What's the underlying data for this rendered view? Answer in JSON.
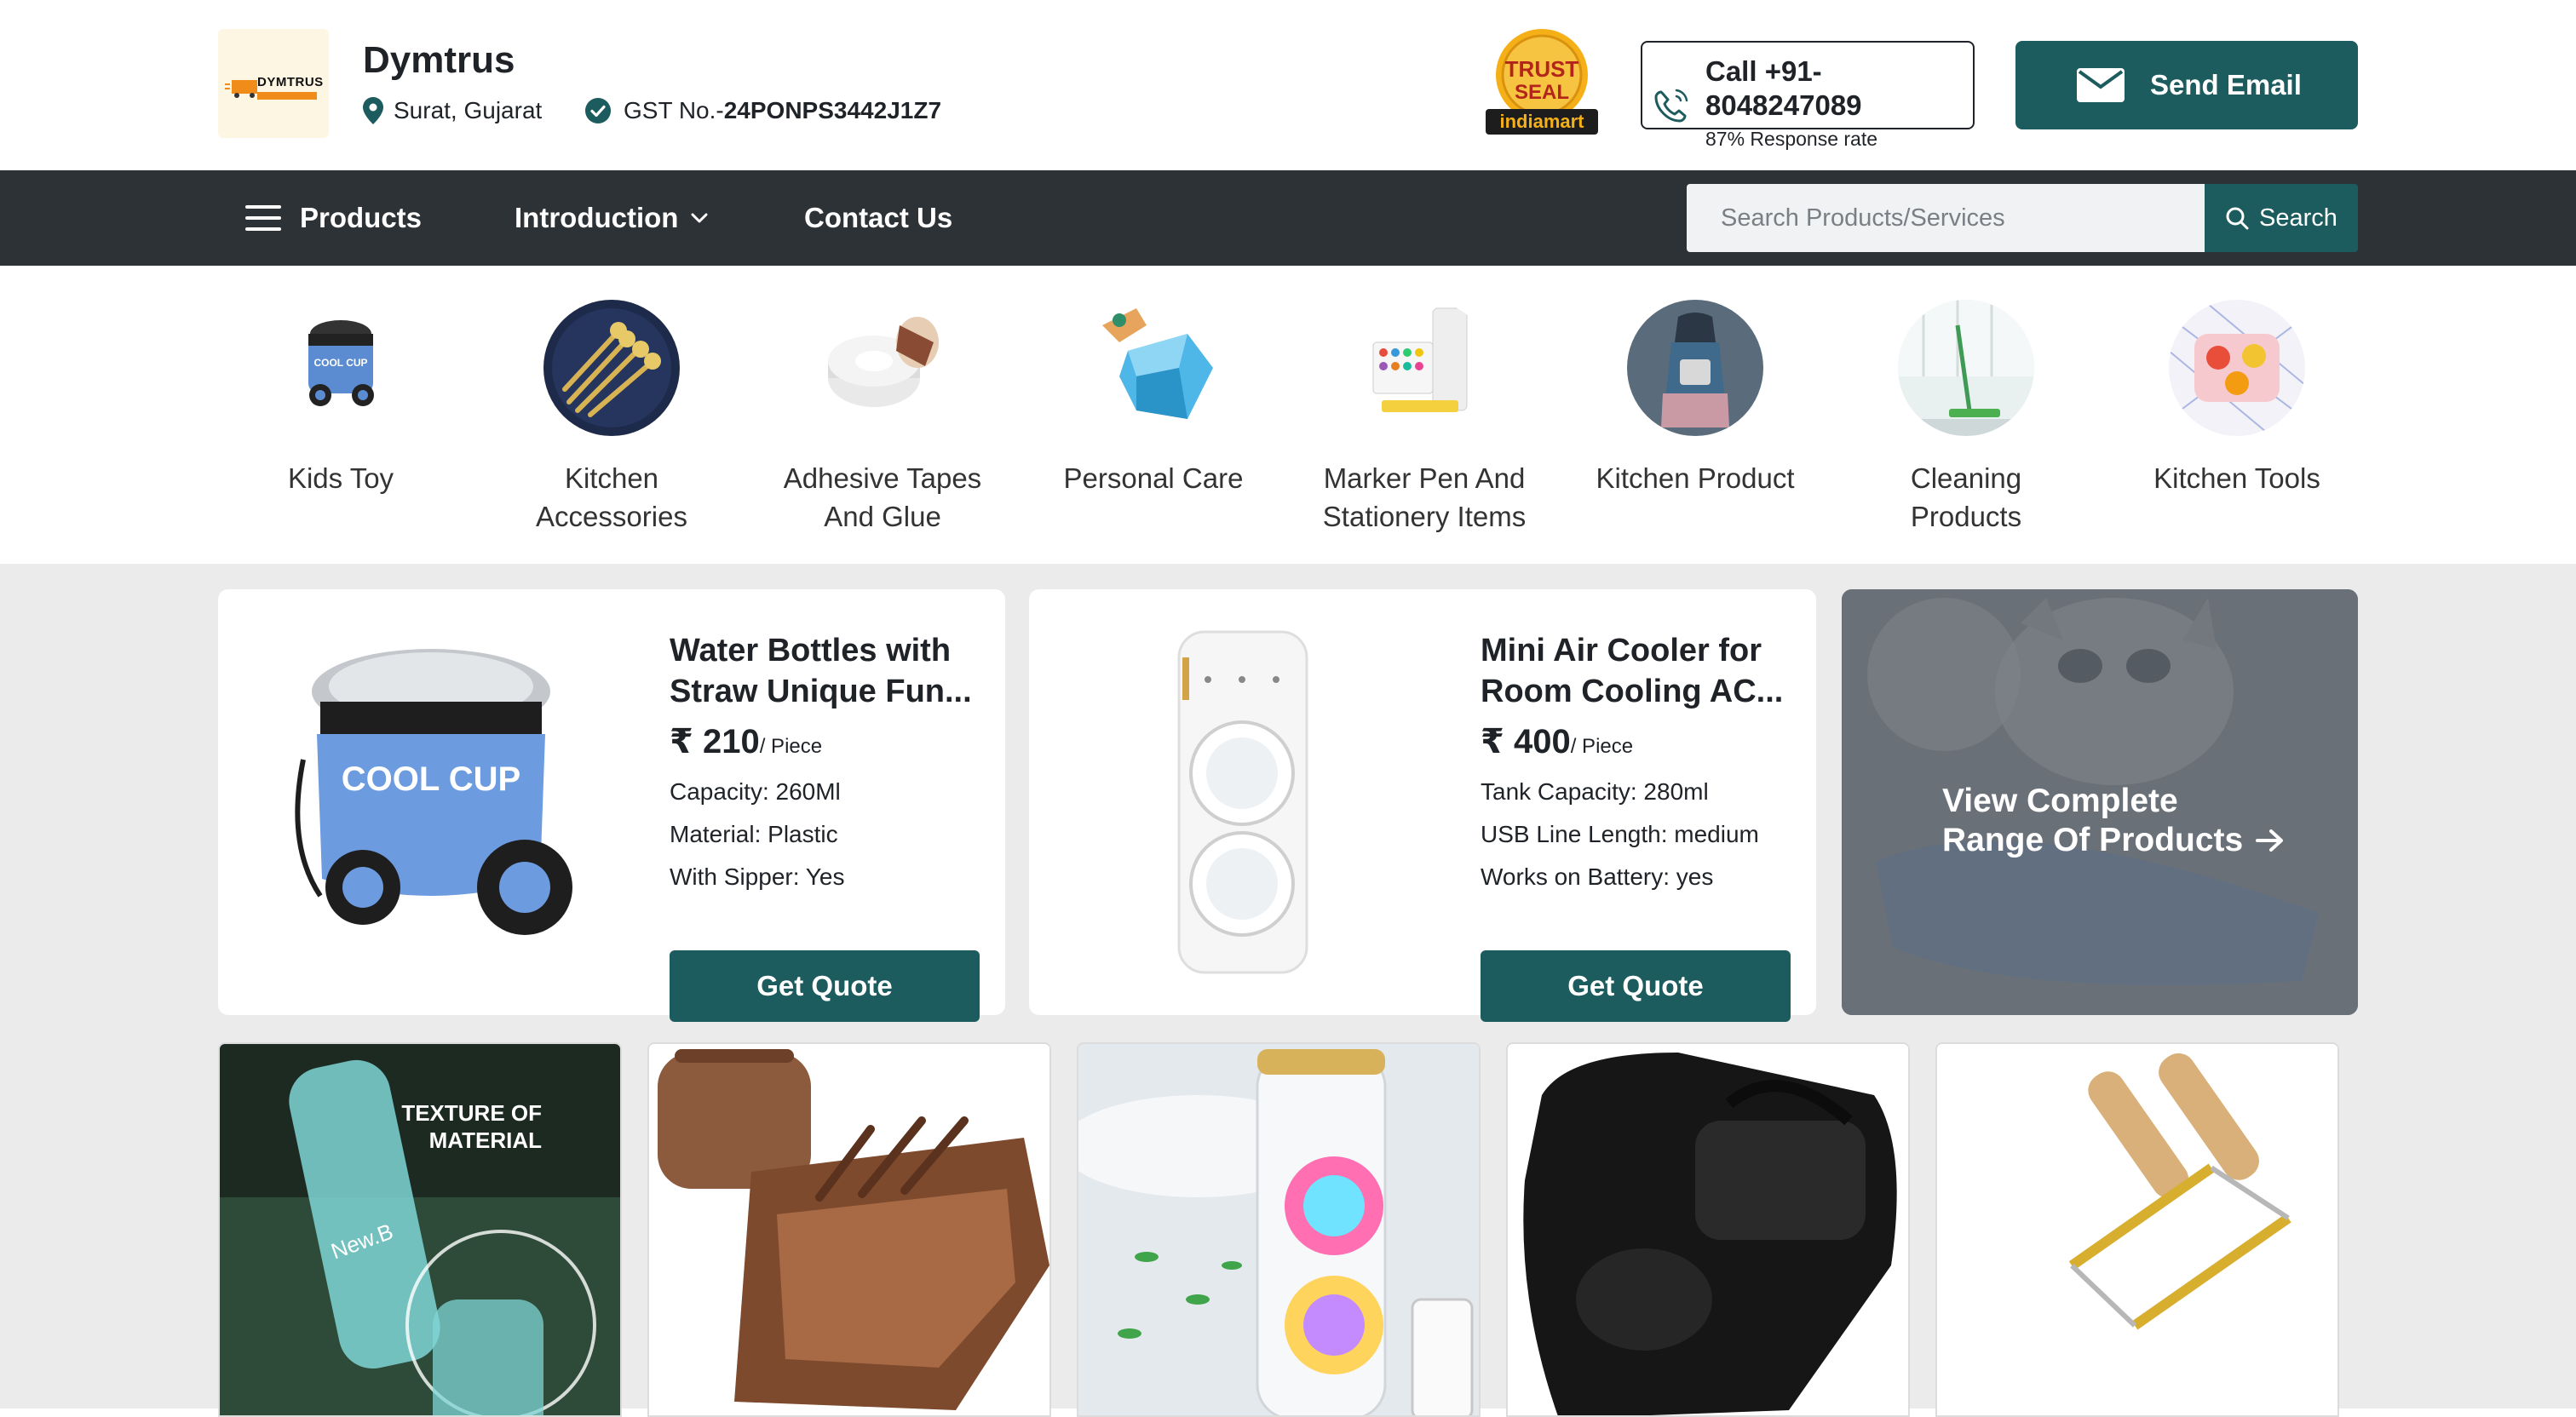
{
  "company": {
    "name": "Dymtrus",
    "logo_text": "DYMTRUS",
    "location": "Surat, Gujarat",
    "gst_prefix": "GST No.-",
    "gst_number": "24PONPS3442J1Z7"
  },
  "badges": {
    "trust_line1": "TRUST",
    "trust_line2": "SEAL",
    "trust_line3": "indiamart"
  },
  "contact": {
    "call_label": "Call +91-",
    "call_number": "8048247089",
    "response_rate": "87% Response rate",
    "email_label": "Send Email"
  },
  "nav": {
    "products": "Products",
    "introduction": "Introduction",
    "contact": "Contact Us",
    "search_placeholder": "Search Products/Services",
    "search_button": "Search"
  },
  "categories": [
    {
      "line1": "Kids Toy",
      "line2": ""
    },
    {
      "line1": "Kitchen",
      "line2": "Accessories"
    },
    {
      "line1": "Adhesive Tapes",
      "line2": "And Glue"
    },
    {
      "line1": "Personal Care",
      "line2": ""
    },
    {
      "line1": "Marker Pen And",
      "line2": "Stationery Items"
    },
    {
      "line1": "Kitchen Product",
      "line2": ""
    },
    {
      "line1": "Cleaning",
      "line2": "Products"
    },
    {
      "line1": "Kitchen Tools",
      "line2": ""
    }
  ],
  "products": [
    {
      "title": "Water Bottles with Straw Unique Fun...",
      "currency": "₹",
      "price": "210",
      "unit": "/ Piece",
      "specs": [
        "Capacity: 260Ml",
        "Material: Plastic",
        "With Sipper: Yes"
      ],
      "cta": "Get Quote",
      "image_text": "COOL CUP"
    },
    {
      "title": "Mini Air Cooler for Room Cooling AC...",
      "currency": "₹",
      "price": "400",
      "unit": "/ Piece",
      "specs": [
        "Tank Capacity: 280ml",
        "USB Line Length: medium",
        "Works on Battery: yes"
      ],
      "cta": "Get Quote"
    }
  ],
  "view_all": {
    "line1": "View Complete",
    "line2": "Range Of Products"
  },
  "thumbs": [
    {
      "caption_line1": "TEXTURE OF",
      "caption_line2": "MATERIAL",
      "bottle_text": "New.B"
    },
    {},
    {},
    {},
    {}
  ],
  "colors": {
    "brand_teal": "#1d5c5e",
    "nav_bg": "#2d3237",
    "content_bg": "#ebebeb",
    "logo_orange": "#f08c1a"
  }
}
